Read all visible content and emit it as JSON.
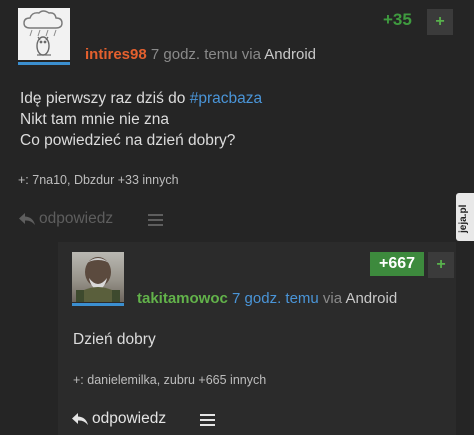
{
  "post": {
    "vote_count": "+35",
    "plus_label": "+",
    "author": "intires98",
    "time": "7 godz. temu",
    "via_label": "via",
    "device": "Android",
    "body_line1_prefix": "Idę pierwszy raz dziś do ",
    "body_line1_tag": "#pracbaza",
    "body_line2": "Nikt tam mnie nie zna",
    "body_line3": "Co powiedzieć na dzień dobry?",
    "voters": "+: 7na10, Dbzdur +33 innych",
    "reply_label": "odpowiedz",
    "reply_icon": "reply-arrow-icon",
    "menu_icon": "hamburger-menu-icon"
  },
  "reply": {
    "vote_count": "+667",
    "plus_label": "+",
    "author": "takitamowoc",
    "time": "7 godz. temu",
    "via_label": "via",
    "device": "Android",
    "body": "Dzień dobry",
    "voters": "+: danielemilka, zubru +665 innych",
    "reply_label": "odpowiedz",
    "reply_icon": "reply-arrow-icon",
    "menu_icon": "hamburger-menu-icon"
  },
  "watermark": "jeja.pl",
  "colors": {
    "background": "#252525",
    "reply_background": "#2b2b2b",
    "author_orange": "#e4602e",
    "author_green": "#62b24a",
    "vote_green": "#3f9b3f",
    "link_blue": "#4a95d8",
    "avatar_bar": "#3b8fd0"
  }
}
